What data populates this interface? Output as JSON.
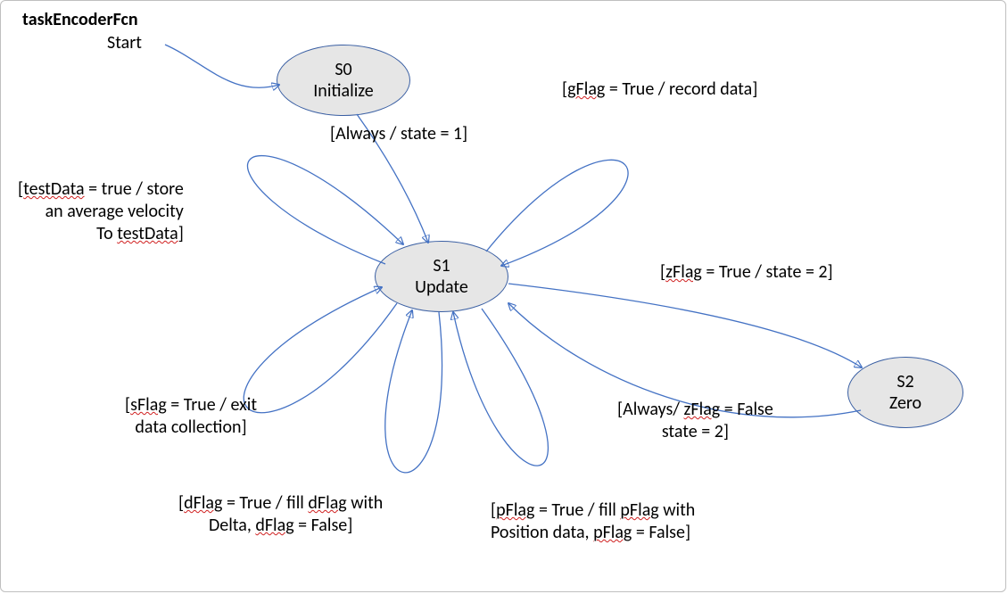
{
  "title": "taskEncoderFcn",
  "start_label": "Start",
  "states": {
    "s0": {
      "id": "S0",
      "name": "Initialize"
    },
    "s1": {
      "id": "S1",
      "name": "Update"
    },
    "s2": {
      "id": "S2",
      "name": "Zero"
    }
  },
  "transitions": {
    "s0_to_s1": "[Always / state = 1]",
    "s1_gflag": "[gFlag = True / record data]",
    "s1_zflag": "[zFlag = True / state = 2]",
    "s2_to_s1_l1": "[Always/ zFlag = False",
    "s2_to_s1_l2": "state = 2]",
    "s1_pflag_l1": "[pFlag = True / fill pFlag with",
    "s1_pflag_l2": "Position data, pFlag = False]",
    "s1_dflag_l1": "[dFlag = True / fill dFlag with",
    "s1_dflag_l2": "Delta, dFlag = False]",
    "s1_sflag_l1": "[sFlag = True / exit",
    "s1_sflag_l2": "data collection]",
    "s1_testdata_l1": "[testData = true / store",
    "s1_testdata_l2": "an average velocity",
    "s1_testdata_l3": "To testData]"
  }
}
